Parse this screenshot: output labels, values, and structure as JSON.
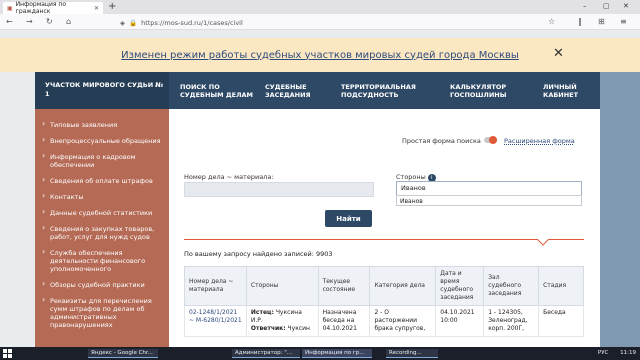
{
  "browser": {
    "tab_title": "Информация по гражданск",
    "url": "https://mos-sud.ru/1/cases/civil"
  },
  "banner": {
    "text": "Изменен режим работы судебных участков мировых судей города Москвы"
  },
  "menu": {
    "left": "УЧАСТОК МИРОВОГО СУДЬИ № 1",
    "items": [
      {
        "label": "ПОИСК ПО СУДЕБНЫМ ДЕЛАМ"
      },
      {
        "label": "СУДЕБНЫЕ ЗАСЕДАНИЯ"
      },
      {
        "label": "ТЕРРИТОРИАЛЬНАЯ ПОДСУДНОСТЬ"
      },
      {
        "label": "КАЛЬКУЛЯТОР ГОСПОШЛИНЫ"
      },
      {
        "label": "ЛИЧНЫЙ КАБИНЕТ"
      }
    ]
  },
  "sidebar": {
    "items": [
      {
        "label": "Типовые заявления"
      },
      {
        "label": "Внепроцессуальные обращения"
      },
      {
        "label": "Информация о кадровом обеспечении"
      },
      {
        "label": "Сведения об оплате штрафов"
      },
      {
        "label": "Контакты"
      },
      {
        "label": "Данные судебной статистики"
      },
      {
        "label": "Сведения о закупках товаров, работ, услуг для нужд судов"
      },
      {
        "label": "Служба обеспечения деятельности финансового уполномоченного"
      },
      {
        "label": "Обзоры судебной практики"
      },
      {
        "label": "Реквизиты для перечисления сумм штрафов по делам об административных правонарушениях"
      }
    ]
  },
  "search": {
    "simple_label": "Простая форма поиска",
    "advanced_label": "Расширенная форма",
    "case_label": "Номер дела ~ материала:",
    "case_value": "",
    "parties_label": "Стороны",
    "parties_value": "Иванов",
    "suggestion": "Иванов",
    "button": "Найти"
  },
  "results": {
    "found": "По вашему запросу найдено записей: 9903",
    "headers": [
      "Номер дела ~ материала",
      "Стороны",
      "Текущее состояние",
      "Категория дела",
      "Дата и время судебного заседания",
      "Зал судебного заседания",
      "Стадия"
    ],
    "rows": [
      {
        "number": "02-1248/1/2021 ~ М-6280/1/2021",
        "party_label": "Истец:",
        "party_value": "Чуксина И.Р.",
        "party2_label": "Ответчик:",
        "party2_value": "Чуксин",
        "state": "Назначена беседа на 04.10.2021",
        "category": "2 - О расторжении брака супругов,",
        "date": "04.10.2021 10:00",
        "hall": "1 - 124305, Зеленоград, корп. 200Г,",
        "stage": "Беседа"
      }
    ]
  },
  "taskbar": {
    "items": [
      {
        "label": "Яндекс - Google Chr..."
      },
      {
        "label": "Администратор: \"..."
      },
      {
        "label": "Информация по гр..."
      },
      {
        "label": "Recording..."
      }
    ],
    "lang": "РУС",
    "time": "11:19"
  }
}
